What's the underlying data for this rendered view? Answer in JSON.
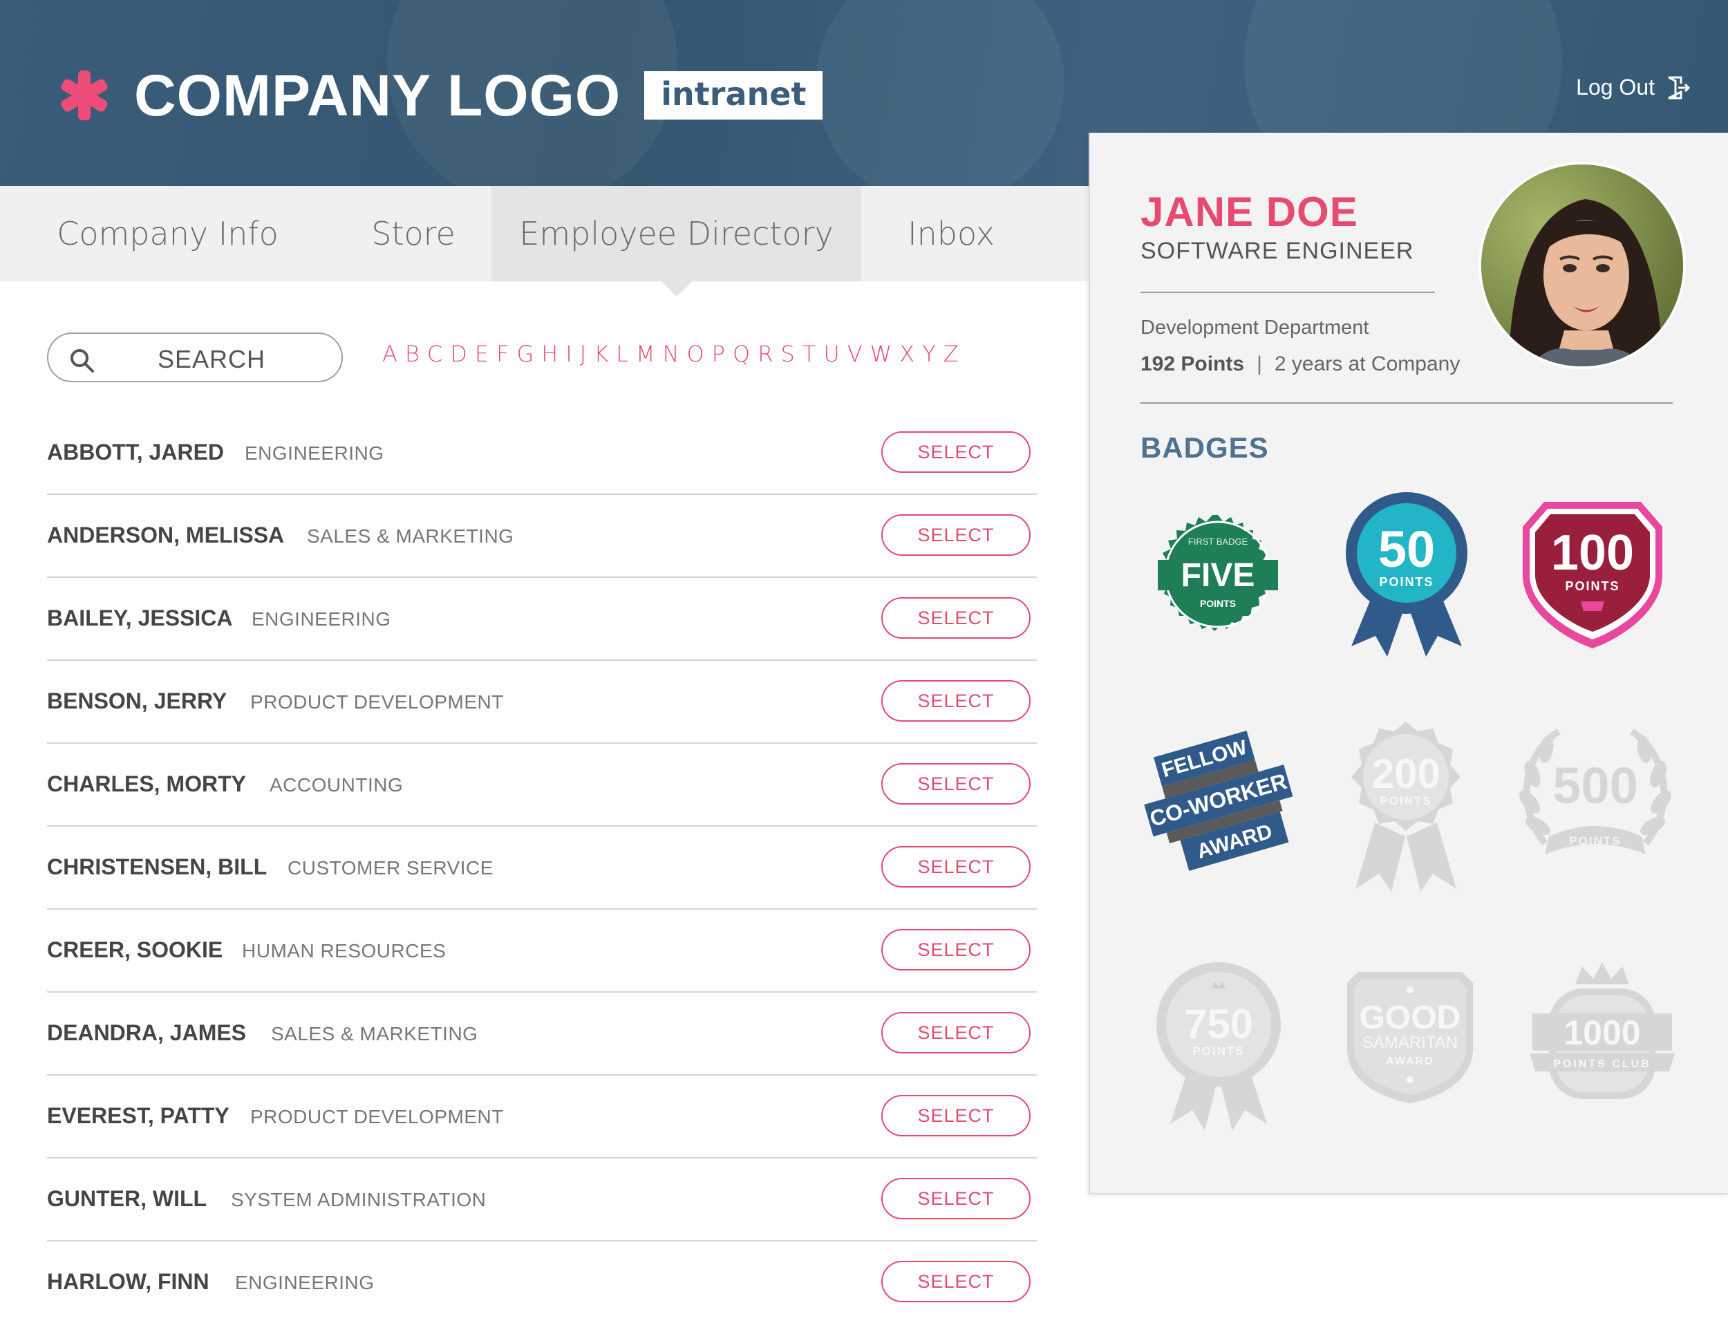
{
  "header": {
    "logo_text": "COMPANY LOGO",
    "intranet_label": "intranet",
    "logout_label": "Log Out",
    "brand_color": "#3b5d7a",
    "accent_color": "#e64b6f"
  },
  "nav": {
    "tabs": [
      {
        "label": "Company Info",
        "active": false
      },
      {
        "label": "Store",
        "active": false
      },
      {
        "label": "Employee Directory",
        "active": true
      },
      {
        "label": "Inbox",
        "active": false
      }
    ]
  },
  "search": {
    "placeholder": "SEARCH"
  },
  "alphabet": [
    "A",
    "B",
    "C",
    "D",
    "E",
    "F",
    "G",
    "H",
    "I",
    "J",
    "K",
    "L",
    "M",
    "N",
    "O",
    "P",
    "Q",
    "R",
    "S",
    "T",
    "U",
    "V",
    "W",
    "X",
    "Y",
    "Z"
  ],
  "directory": {
    "select_label": "SELECT",
    "rows": [
      {
        "name": "ABBOTT, JARED",
        "dept": "ENGINEERING"
      },
      {
        "name": "ANDERSON, MELISSA",
        "dept": "SALES & MARKETING"
      },
      {
        "name": "BAILEY, JESSICA",
        "dept": "ENGINEERING"
      },
      {
        "name": "BENSON, JERRY",
        "dept": "PRODUCT DEVELOPMENT"
      },
      {
        "name": "CHARLES, MORTY",
        "dept": "ACCOUNTING"
      },
      {
        "name": "CHRISTENSEN, BILL",
        "dept": "CUSTOMER SERVICE"
      },
      {
        "name": "CREER, SOOKIE",
        "dept": "HUMAN RESOURCES"
      },
      {
        "name": "DEANDRA, JAMES",
        "dept": "SALES & MARKETING"
      },
      {
        "name": "EVEREST, PATTY",
        "dept": "PRODUCT DEVELOPMENT"
      },
      {
        "name": "GUNTER, WILL",
        "dept": "SYSTEM ADMINISTRATION"
      },
      {
        "name": "HARLOW, FINN",
        "dept": "ENGINEERING"
      }
    ]
  },
  "profile": {
    "name": "JANE DOE",
    "title": "SOFTWARE ENGINEER",
    "department": "Development Department",
    "points": "192 Points",
    "separator": "|",
    "tenure": "2 years at Company",
    "badges_title": "BADGES",
    "badges": {
      "five": {
        "top": "FIRST BADGE",
        "main": "FIVE",
        "sub": "POINTS",
        "earned": true
      },
      "fifty": {
        "main": "50",
        "sub": "POINTS",
        "earned": true
      },
      "hundred": {
        "main": "100",
        "sub": "POINTS",
        "earned": true
      },
      "fellow": {
        "line1": "FELLOW",
        "line2": "CO-WORKER",
        "line3": "AWARD",
        "earned": true
      },
      "two_hundred": {
        "main": "200",
        "sub": "POINTS",
        "earned": false
      },
      "five_hundred": {
        "main": "500",
        "sub": "POINTS",
        "earned": false
      },
      "seven_fifty": {
        "main": "750",
        "sub": "POINTS",
        "earned": false
      },
      "good_samaritan": {
        "line1": "GOOD",
        "line2": "SAMARITAN",
        "line3": "AWARD",
        "earned": false
      },
      "thousand": {
        "main": "1000",
        "sub": "POINTS CLUB",
        "earned": false
      }
    }
  }
}
